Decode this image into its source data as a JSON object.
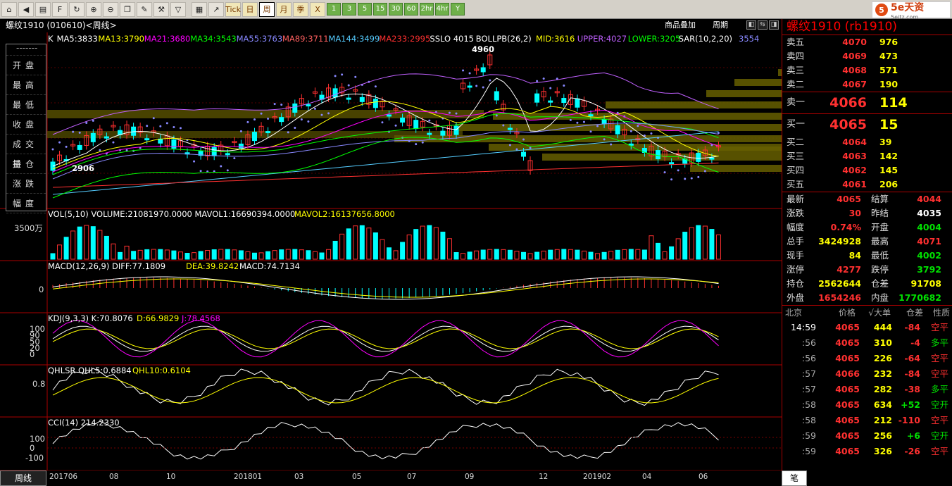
{
  "toolbar": {
    "icons": [
      "home-icon",
      "back-icon",
      "list-icon",
      "f10-icon",
      "refresh-icon",
      "zoom-in-icon",
      "zoom-out-icon",
      "window-icon",
      "draw-icon",
      "tools-icon",
      "filter-icon"
    ],
    "buttons": [
      "grid-icon",
      "line-chart-icon",
      "Tick",
      "日",
      "周",
      "月",
      "季",
      "X",
      "1",
      "3",
      "5",
      "15",
      "30",
      "60",
      "2hr",
      "4hr",
      "Y"
    ],
    "active_period": "周"
  },
  "logo": {
    "text": "5e天资",
    "sub": "5eitz.com"
  },
  "titlebar": {
    "title": "螺纹1910 (010610)<周线>",
    "overlay": "商品叠加",
    "period": "周期"
  },
  "indicators": {
    "main": [
      "K",
      "MA5:3833",
      "MA13:3790",
      "MA21:3680",
      "MA34:3543",
      "MA55:3763",
      "MA89:3711",
      "MA144:3499",
      "MA233:2995",
      "SSLO 4015",
      "BOLLPB(26,2)",
      "MID:3616",
      "UPPER:4027",
      "LOWER:3205",
      "SAR(10,2,20)",
      "3554"
    ],
    "main_colors": [
      "#fff",
      "#fff",
      "#ff0",
      "#f0f",
      "#0f0",
      "#88f",
      "#ff6060",
      "#5cf",
      "#ff3030",
      "#fff",
      "#fff",
      "#ff0",
      "#c060ff",
      "#0f0",
      "#fff",
      "#88f"
    ],
    "high_label": "4960",
    "low_label": "2906",
    "vol": "VOL(5,10) VOLUME:21081970.0000 MAVOL1:16690394.0000",
    "vol2": "MAVOL2:16137656.8000",
    "vol_axis": "3500万",
    "macd": "MACD(12,26,9) DIFF:77.1809",
    "macd2": "DEA:39.8242",
    "macd3": "MACD:74.7134",
    "macd_axis": "0",
    "kdj": "KDJ(9,3,3) K:70.8076",
    "kdj2": "D:66.9829",
    "kdj3": "J:78.4568",
    "kdj_axis": [
      "100",
      "90",
      "50",
      "20",
      "0"
    ],
    "qhlsr": "QHLSR QHL5:0.6884",
    "qhlsr2": "QHL10:0.6104",
    "qhlsr_axis": "0.8",
    "cci": "CCI(14) 214.2330",
    "cci_axis": [
      "100",
      "0",
      "-100"
    ]
  },
  "infobox": {
    "dash": "-------",
    "items": [
      "开盘",
      "最高",
      "最低",
      "收盘",
      "成交量",
      "持仓",
      "涨跌",
      "幅度"
    ]
  },
  "xaxis": {
    "period_label": "周线",
    "labels": [
      "201706",
      "08",
      "10",
      "201801",
      "03",
      "05",
      "07",
      "09",
      "12",
      "201902",
      "04",
      "06"
    ]
  },
  "quote": {
    "title": "螺纹1910 (rb1910)",
    "sells": [
      {
        "label": "卖五",
        "price": "4070",
        "vol": "976"
      },
      {
        "label": "卖四",
        "price": "4069",
        "vol": "473"
      },
      {
        "label": "卖三",
        "price": "4068",
        "vol": "571"
      },
      {
        "label": "卖二",
        "price": "4067",
        "vol": "190"
      }
    ],
    "sell1": {
      "label": "卖一",
      "price": "4066",
      "vol": "114"
    },
    "buy1": {
      "label": "买一",
      "price": "4065",
      "vol": "15"
    },
    "buys": [
      {
        "label": "买二",
        "price": "4064",
        "vol": "39"
      },
      {
        "label": "买三",
        "price": "4063",
        "vol": "142"
      },
      {
        "label": "买四",
        "price": "4062",
        "vol": "145"
      },
      {
        "label": "买五",
        "price": "4061",
        "vol": "206"
      }
    ],
    "stats": [
      {
        "k": "最新",
        "v": "4065",
        "vc": "red",
        "k2": "结算",
        "v2": "4044",
        "v2c": "red"
      },
      {
        "k": "涨跌",
        "v": "30",
        "vc": "red",
        "k2": "昨结",
        "v2": "4035",
        "v2c": "wht"
      },
      {
        "k": "幅度",
        "v": "0.74%",
        "vc": "red",
        "k2": "开盘",
        "v2": "4004",
        "v2c": "grn"
      },
      {
        "k": "总手",
        "v": "3424928",
        "vc": "yel",
        "k2": "最高",
        "v2": "4071",
        "v2c": "red"
      },
      {
        "k": "现手",
        "v": "84",
        "vc": "yel",
        "k2": "最低",
        "v2": "4002",
        "v2c": "grn"
      },
      {
        "k": "涨停",
        "v": "4277",
        "vc": "red",
        "k2": "跌停",
        "v2": "3792",
        "v2c": "grn"
      },
      {
        "k": "持仓",
        "v": "2562644",
        "vc": "yel",
        "k2": "仓差",
        "v2": "91708",
        "v2c": "yel"
      },
      {
        "k": "外盘",
        "v": "1654246",
        "vc": "red",
        "k2": "内盘",
        "v2": "1770682",
        "v2c": "grn"
      }
    ],
    "tick_header": [
      "北京",
      "价格",
      "√大单",
      "仓差",
      "性质"
    ],
    "ticks": [
      {
        "t": "14:59",
        "p": "4065",
        "d": "444",
        "o": "-84",
        "oc": "red",
        "n": "空平",
        "nc": "red"
      },
      {
        "t": ":56",
        "p": "4065",
        "d": "310",
        "o": "-4",
        "oc": "red",
        "n": "多平",
        "nc": "grn"
      },
      {
        "t": ":56",
        "p": "4065",
        "d": "226",
        "o": "-64",
        "oc": "red",
        "n": "空平",
        "nc": "red"
      },
      {
        "t": ":57",
        "p": "4066",
        "d": "232",
        "o": "-84",
        "oc": "red",
        "n": "空平",
        "nc": "red"
      },
      {
        "t": ":57",
        "p": "4065",
        "d": "282",
        "o": "-38",
        "oc": "red",
        "n": "多平",
        "nc": "grn"
      },
      {
        "t": ":58",
        "p": "4065",
        "d": "634",
        "o": "+52",
        "oc": "grn",
        "n": "空开",
        "nc": "grn"
      },
      {
        "t": ":58",
        "p": "4065",
        "d": "212",
        "o": "-110",
        "oc": "red",
        "n": "空平",
        "nc": "red"
      },
      {
        "t": ":59",
        "p": "4065",
        "d": "256",
        "o": "+6",
        "oc": "grn",
        "n": "空开",
        "nc": "grn"
      },
      {
        "t": ":59",
        "p": "4065",
        "d": "326",
        "o": "-26",
        "oc": "red",
        "n": "空平",
        "nc": "red"
      }
    ],
    "bottom_tab": "笔"
  }
}
